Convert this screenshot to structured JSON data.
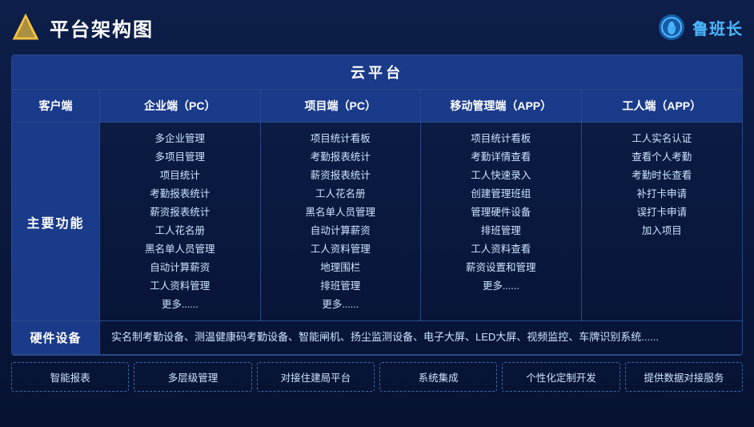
{
  "header": {
    "title": "平台架构图",
    "brand_name": "鲁班长"
  },
  "cloud_platform": {
    "label": "云平台"
  },
  "columns": {
    "client": "客户端",
    "enterprise_pc": "企业端（PC）",
    "project_pc": "项目端（PC）",
    "mobile_app": "移动管理端（APP）",
    "worker_app": "工人端（APP）"
  },
  "main_function_label": "主要功能",
  "enterprise_features": [
    "多企业管理",
    "多项目管理",
    "项目统计",
    "考勤报表统计",
    "薪资报表统计",
    "工人花名册",
    "黑名单人员管理",
    "自动计算薪资",
    "工人资料管理",
    "更多......"
  ],
  "project_features": [
    "项目统计看板",
    "考勤报表统计",
    "薪资报表统计",
    "工人花名册",
    "黑名单人员管理",
    "自动计算薪资",
    "工人资料管理",
    "地理围栏",
    "排班管理",
    "更多......"
  ],
  "mobile_features": [
    "项目统计看板",
    "考勤详情查看",
    "工人快速录入",
    "创建管理班组",
    "管理硬件设备",
    "排班管理",
    "工人资料查看",
    "薪资设置和管理",
    "更多......"
  ],
  "worker_features": [
    "工人实名认证",
    "查看个人考勤",
    "考勤时长查看",
    "补打卡申请",
    "误打卡申请",
    "加入项目"
  ],
  "hardware": {
    "label": "硬件设备",
    "content": "实名制考勤设备、测温健康码考勤设备、智能闸机、扬尘监测设备、电子大屏、LED大屏、视频监控、车牌识别系统......"
  },
  "tags": [
    "智能报表",
    "多层级管理",
    "对接住建局平台",
    "系统集成",
    "个性化定制开发",
    "提供数据对接服务"
  ]
}
